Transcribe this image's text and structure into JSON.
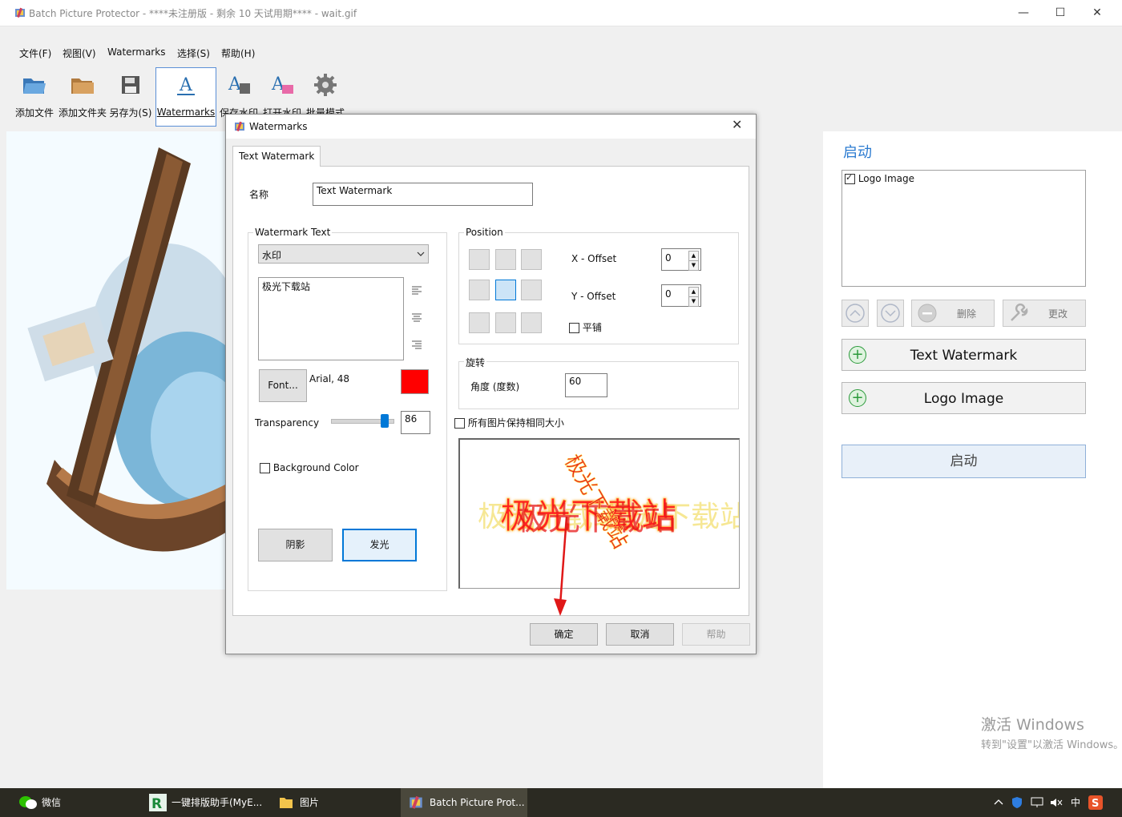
{
  "window": {
    "title": "Batch Picture Protector - ****未注册版 - 剩余 10 天试用期**** - wait.gif",
    "min": "—",
    "max": "☐",
    "close": "✕"
  },
  "menu": [
    "文件(F)",
    "视图(V)",
    "Watermarks",
    "选择(S)",
    "帮助(H)"
  ],
  "toolbar": [
    {
      "label": "添加文件",
      "icon": "folder-open-icon"
    },
    {
      "label": "添加文件夹",
      "icon": "folder-icon"
    },
    {
      "label": "另存为(S)",
      "icon": "save-icon"
    },
    {
      "label": "Watermarks",
      "icon": "watermark-a-icon"
    },
    {
      "label": "保存水印",
      "icon": "save-watermark-icon"
    },
    {
      "label": "打开水印",
      "icon": "open-watermark-icon"
    },
    {
      "label": "批量模式",
      "icon": "gear-icon"
    }
  ],
  "dialog": {
    "title": "Watermarks",
    "close": "✕",
    "tab": "Text Watermark",
    "name_label": "名称",
    "name_value": "Text Watermark",
    "wm_text_group": "Watermark Text",
    "wm_type_selected": "水印",
    "wm_text_value": "极光下载站",
    "font_button": "Font...",
    "font_value": "Arial, 48",
    "font_color": "#ff0000",
    "transparency_label": "Transparency",
    "transparency_value": "86",
    "transparency_level": 0.86,
    "bg_color_label": "Background Color",
    "shadow_button": "阴影",
    "glow_button": "发光",
    "position_group": "Position",
    "x_offset_label": "X - Offset",
    "x_offset_value": "0",
    "y_offset_label": "Y - Offset",
    "y_offset_value": "0",
    "tile_label": "平铺",
    "rotate_group": "旋转",
    "angle_label": "角度 (度数)",
    "angle_value": "60",
    "same_size_label": "所有图片保持相同大小",
    "ok_button": "确定",
    "cancel_button": "取消",
    "help_button": "帮助"
  },
  "right_panel": {
    "title": "启动",
    "list_item": "Logo Image",
    "delete_button": "删除",
    "edit_button": "更改",
    "add_text_watermark": "Text Watermark",
    "add_logo_image": "Logo Image",
    "start_button": "启动"
  },
  "activate": {
    "line1": "激活 Windows",
    "line2": "转到\"设置\"以激活 Windows。"
  },
  "taskbar": [
    {
      "label": "微信",
      "icon": "wechat-icon"
    },
    {
      "label": "一键排版助手(MyE...",
      "icon": "typeset-app-icon"
    },
    {
      "label": "图片",
      "icon": "folder-icon"
    },
    {
      "label": "Batch Picture Prot...",
      "icon": "batch-picture-icon"
    }
  ],
  "tray": {
    "ime": "中"
  },
  "colors": {
    "accent": "#2a7ad0",
    "taskbar": "#2b2a22",
    "font_color": "#ff0000"
  }
}
